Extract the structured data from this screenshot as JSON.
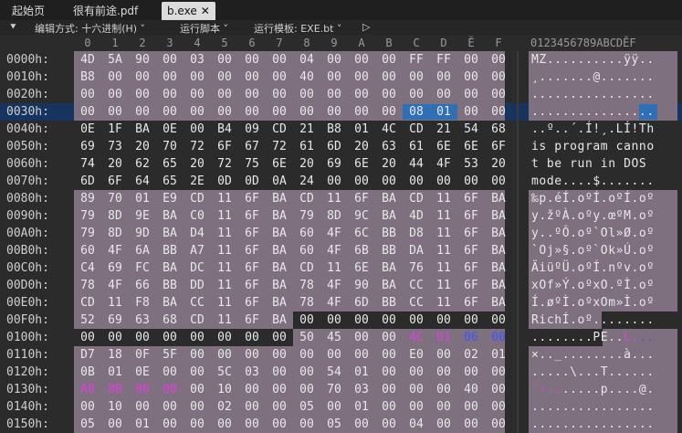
{
  "tabs": [
    {
      "label": "起始页",
      "active": false
    },
    {
      "label": "很有前途.pdf",
      "active": false
    },
    {
      "label": "b.exe",
      "active": true,
      "close": "✕"
    }
  ],
  "toolbar": {
    "arrow": "⯆",
    "edit_mode": "编辑方式: 十六进制(H) ˅",
    "run_script": "运行脚本 ˅",
    "run_template": "运行模板: EXE.bt ˅",
    "play": "▷"
  },
  "column_headers": [
    "0",
    "1",
    "2",
    "3",
    "4",
    "5",
    "6",
    "7",
    "8",
    "9",
    "A",
    "B",
    "C",
    "D",
    "Ĕ",
    "F"
  ],
  "ascii_header": "0123456789ABCDĔF",
  "colors": {
    "background": "#2b2b2b",
    "template_highlight": "#7e707e",
    "selection": "#2f6fb5",
    "cursor_row": "#16345e",
    "magenta_text": "#e23ee2",
    "blue_text": "#3a55ff",
    "normal_text": "#e8e8e8"
  },
  "rows": [
    {
      "addr": "0000h:",
      "hex": [
        "4D",
        "5A",
        "90",
        "00",
        "03",
        "00",
        "00",
        "00",
        "04",
        "00",
        "00",
        "00",
        "FF",
        "FF",
        "00",
        "00"
      ],
      "ascii": "MZ..........ÿÿ..",
      "hl": "all"
    },
    {
      "addr": "0010h:",
      "hex": [
        "B8",
        "00",
        "00",
        "00",
        "00",
        "00",
        "00",
        "00",
        "40",
        "00",
        "00",
        "00",
        "00",
        "00",
        "00",
        "00"
      ],
      "ascii": "¸.......@.......",
      "hl": "all"
    },
    {
      "addr": "0020h:",
      "hex": [
        "00",
        "00",
        "00",
        "00",
        "00",
        "00",
        "00",
        "00",
        "00",
        "00",
        "00",
        "00",
        "00",
        "00",
        "00",
        "00"
      ],
      "ascii": "................",
      "hl": "all"
    },
    {
      "addr": "0030h:",
      "hex": [
        "00",
        "00",
        "00",
        "00",
        "00",
        "00",
        "00",
        "00",
        "00",
        "00",
        "00",
        "00",
        "08",
        "01",
        "00",
        "00"
      ],
      "ascii": "................",
      "hl": "all",
      "cursor": true,
      "sel": [
        12,
        13
      ]
    },
    {
      "addr": "0040h:",
      "hex": [
        "0E",
        "1F",
        "BA",
        "0E",
        "00",
        "B4",
        "09",
        "CD",
        "21",
        "B8",
        "01",
        "4C",
        "CD",
        "21",
        "54",
        "68"
      ],
      "ascii": "..º..´.Í!¸.LÍ!Th",
      "hl": "none"
    },
    {
      "addr": "0050h:",
      "hex": [
        "69",
        "73",
        "20",
        "70",
        "72",
        "6F",
        "67",
        "72",
        "61",
        "6D",
        "20",
        "63",
        "61",
        "6E",
        "6E",
        "6F"
      ],
      "ascii": "is program canno",
      "hl": "none"
    },
    {
      "addr": "0060h:",
      "hex": [
        "74",
        "20",
        "62",
        "65",
        "20",
        "72",
        "75",
        "6E",
        "20",
        "69",
        "6E",
        "20",
        "44",
        "4F",
        "53",
        "20"
      ],
      "ascii": "t be run in DOS ",
      "hl": "none"
    },
    {
      "addr": "0070h:",
      "hex": [
        "6D",
        "6F",
        "64",
        "65",
        "2E",
        "0D",
        "0D",
        "0A",
        "24",
        "00",
        "00",
        "00",
        "00",
        "00",
        "00",
        "00"
      ],
      "ascii": "mode....$.......",
      "hl": "none"
    },
    {
      "addr": "0080h:",
      "hex": [
        "89",
        "70",
        "01",
        "E9",
        "CD",
        "11",
        "6F",
        "BA",
        "CD",
        "11",
        "6F",
        "BA",
        "CD",
        "11",
        "6F",
        "BA"
      ],
      "ascii": "‰p.éÍ.oºÍ.oºÍ.oº",
      "hl": "all"
    },
    {
      "addr": "0090h:",
      "hex": [
        "79",
        "8D",
        "9E",
        "BA",
        "C0",
        "11",
        "6F",
        "BA",
        "79",
        "8D",
        "9C",
        "BA",
        "4D",
        "11",
        "6F",
        "BA"
      ],
      "ascii": "y.žºÀ.oºy.œºM.oº",
      "hl": "all"
    },
    {
      "addr": "00A0h:",
      "hex": [
        "79",
        "8D",
        "9D",
        "BA",
        "D4",
        "11",
        "6F",
        "BA",
        "60",
        "4F",
        "6C",
        "BB",
        "D8",
        "11",
        "6F",
        "BA"
      ],
      "ascii": "y..ºÔ.oº`Ol»Ø.oº",
      "hl": "all"
    },
    {
      "addr": "00B0h:",
      "hex": [
        "60",
        "4F",
        "6A",
        "BB",
        "A7",
        "11",
        "6F",
        "BA",
        "60",
        "4F",
        "6B",
        "BB",
        "DA",
        "11",
        "6F",
        "BA"
      ],
      "ascii": "`Oj»§.oº`Ok»Ú.oº",
      "hl": "all"
    },
    {
      "addr": "00C0h:",
      "hex": [
        "C4",
        "69",
        "FC",
        "BA",
        "DC",
        "11",
        "6F",
        "BA",
        "CD",
        "11",
        "6E",
        "BA",
        "76",
        "11",
        "6F",
        "BA"
      ],
      "ascii": "ÄiüºÜ.oºÍ.nºv.oº",
      "hl": "all"
    },
    {
      "addr": "00D0h:",
      "hex": [
        "78",
        "4F",
        "66",
        "BB",
        "DD",
        "11",
        "6F",
        "BA",
        "78",
        "4F",
        "90",
        "BA",
        "CC",
        "11",
        "6F",
        "BA"
      ],
      "ascii": "xOf»Ý.oºxO.ºÌ.oº",
      "hl": "all"
    },
    {
      "addr": "00E0h:",
      "hex": [
        "CD",
        "11",
        "F8",
        "BA",
        "CC",
        "11",
        "6F",
        "BA",
        "78",
        "4F",
        "6D",
        "BB",
        "CC",
        "11",
        "6F",
        "BA"
      ],
      "ascii": "Í.øºÌ.oºxOm»Ì.oº",
      "hl": "all"
    },
    {
      "addr": "00F0h:",
      "hex": [
        "52",
        "69",
        "63",
        "68",
        "CD",
        "11",
        "6F",
        "BA",
        "00",
        "00",
        "00",
        "00",
        "00",
        "00",
        "00",
        "00"
      ],
      "ascii": "RichÍ.oº........",
      "hl": "first8"
    },
    {
      "addr": "0100h:",
      "hex": [
        "00",
        "00",
        "00",
        "00",
        "00",
        "00",
        "00",
        "00",
        "50",
        "45",
        "00",
        "00",
        "4C",
        "01",
        "06",
        "00"
      ],
      "ascii": "........PE..L...",
      "hl": "last8",
      "magenta": [
        12,
        13
      ],
      "blue": [
        14,
        15
      ],
      "amagenta": [
        12,
        13
      ],
      "ablue": [
        14,
        15
      ]
    },
    {
      "addr": "0110h:",
      "hex": [
        "D7",
        "18",
        "0F",
        "5F",
        "00",
        "00",
        "00",
        "00",
        "00",
        "00",
        "00",
        "00",
        "E0",
        "00",
        "02",
        "01"
      ],
      "ascii": "×.._........à...",
      "hl": "all"
    },
    {
      "addr": "0120h:",
      "hex": [
        "0B",
        "01",
        "0E",
        "00",
        "00",
        "5C",
        "03",
        "00",
        "00",
        "54",
        "01",
        "00",
        "00",
        "00",
        "00",
        "00"
      ],
      "ascii": ".....\\...T......",
      "hl": "all"
    },
    {
      "addr": "0130h:",
      "hex": [
        "A8",
        "8B",
        "00",
        "00",
        "00",
        "10",
        "00",
        "00",
        "00",
        "70",
        "03",
        "00",
        "00",
        "00",
        "40",
        "00"
      ],
      "ascii": "¨‹.......p....@.",
      "hl": "all",
      "magenta": [
        0,
        1,
        2,
        3
      ],
      "amagenta": [
        0,
        1,
        2,
        3
      ]
    },
    {
      "addr": "0140h:",
      "hex": [
        "00",
        "10",
        "00",
        "00",
        "00",
        "02",
        "00",
        "00",
        "05",
        "00",
        "01",
        "00",
        "00",
        "00",
        "00",
        "00"
      ],
      "ascii": "................",
      "hl": "all"
    },
    {
      "addr": "0150h:",
      "hex": [
        "05",
        "00",
        "01",
        "00",
        "00",
        "00",
        "00",
        "00",
        "00",
        "05",
        "00",
        "00",
        "04",
        "00",
        "00",
        "00"
      ],
      "ascii": "................",
      "hl": "all"
    }
  ]
}
